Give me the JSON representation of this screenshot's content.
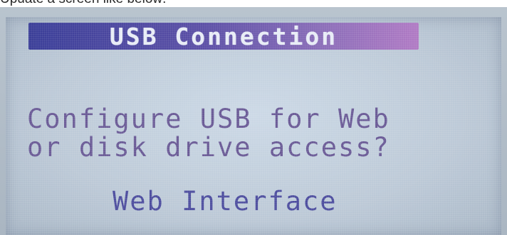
{
  "caption": "Upuate a screen like below:",
  "screen": {
    "title": "USB Connection",
    "prompt_line1": "Configure USB for Web",
    "prompt_line2": "or disk drive access?",
    "selected_option": "Web Interface"
  },
  "colors": {
    "title_bar_start": "#3a3e98",
    "title_bar_end": "#b07ac4",
    "prompt_text": "#6a5a96",
    "option_text": "#4c4c9e",
    "lcd_background": "#c6d3e0"
  }
}
